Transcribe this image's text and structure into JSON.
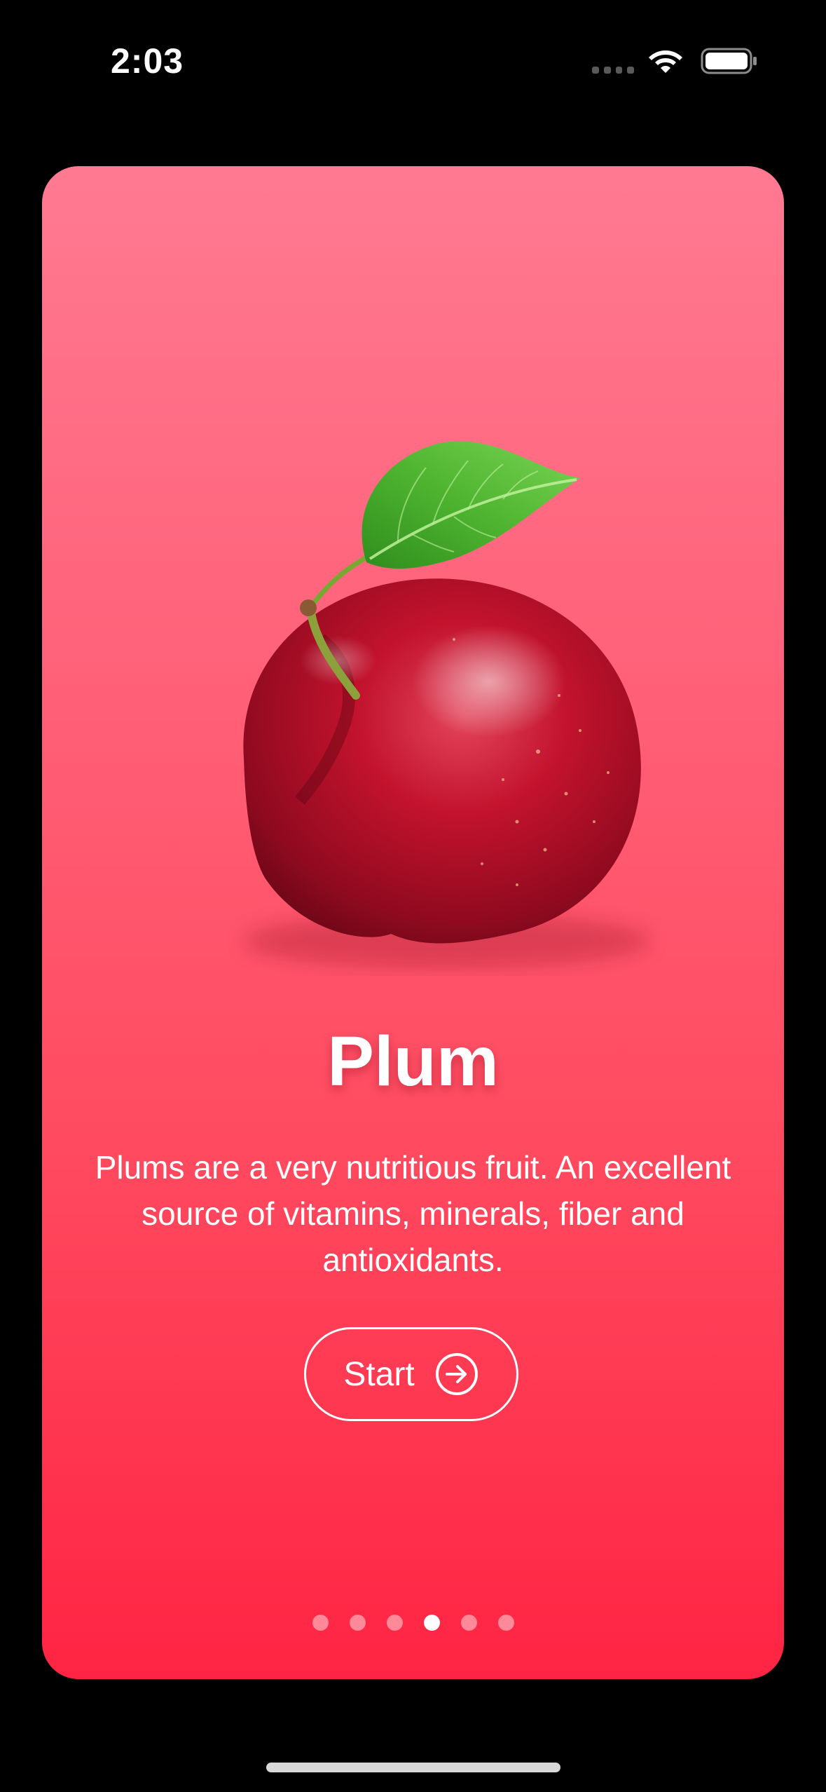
{
  "status_bar": {
    "time": "2:03",
    "icons": [
      "cell-signal-icon",
      "wifi-icon",
      "battery-icon"
    ]
  },
  "card": {
    "title": "Plum",
    "description": "Plums are a very nutritious fruit. An excellent source of vitamins, minerals, fiber and antioxidants.",
    "start_button": {
      "label": "Start",
      "icon": "arrow-right-circle-icon"
    },
    "image": "plum-image",
    "gradient_colors": [
      "#ff7a91",
      "#ff2443"
    ]
  },
  "pagination": {
    "total": 6,
    "active_index": 3
  }
}
